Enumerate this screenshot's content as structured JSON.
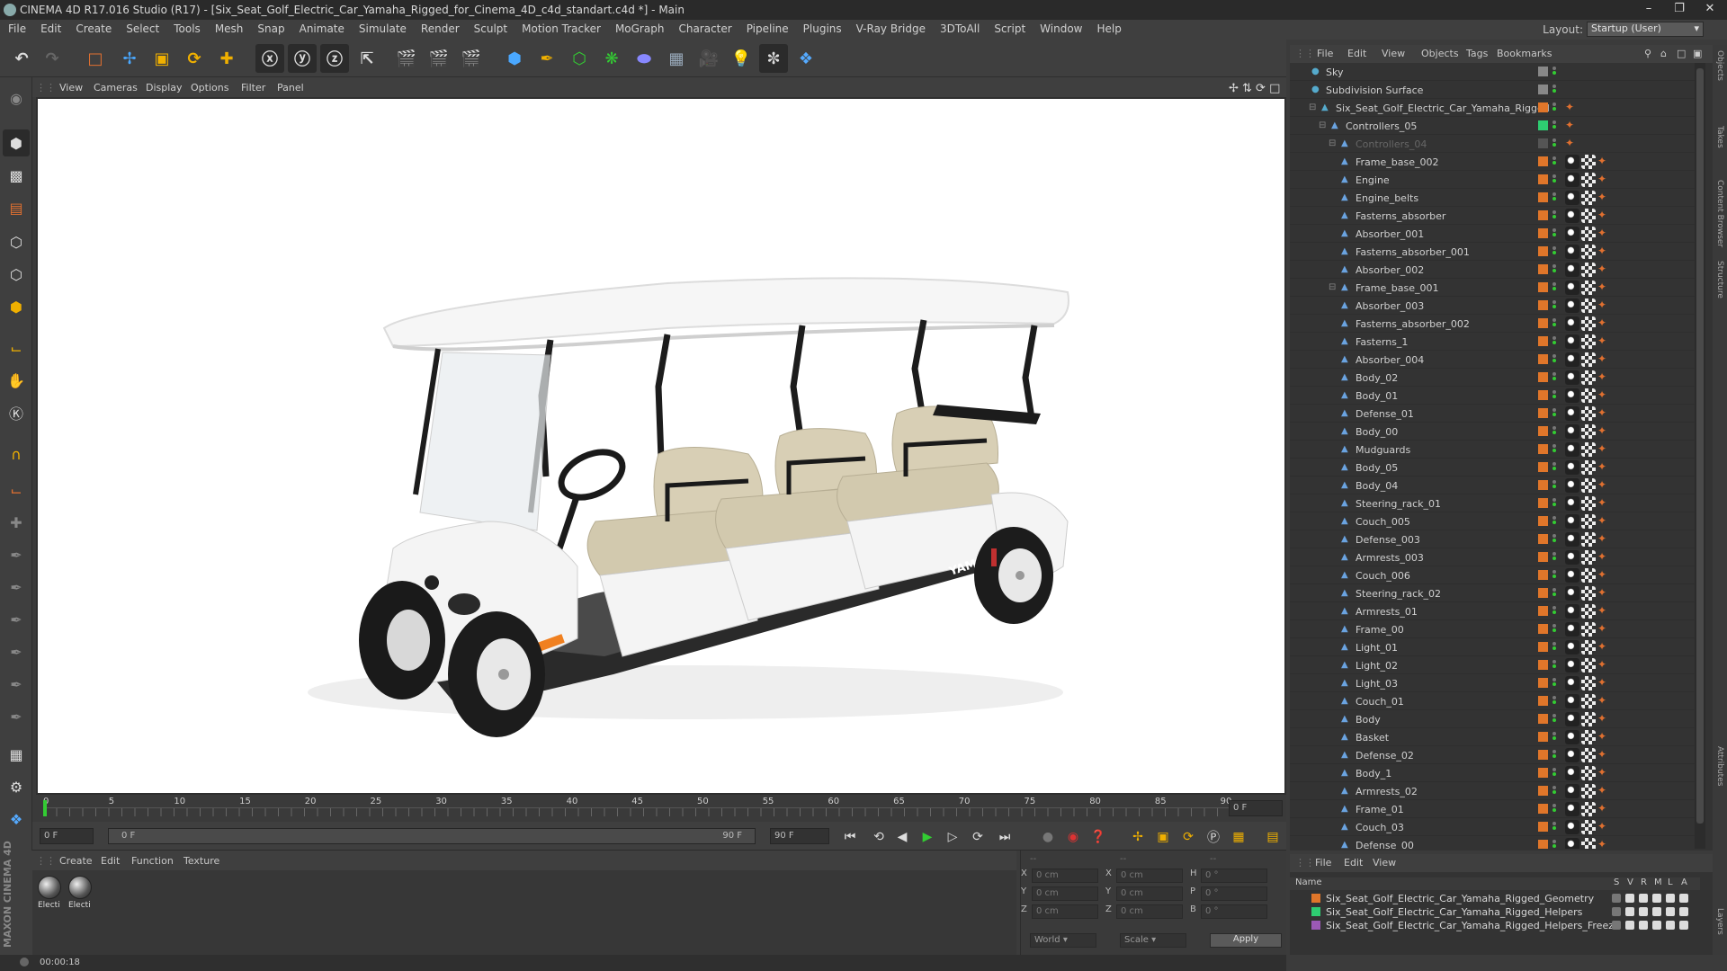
{
  "window": {
    "title": "CINEMA 4D R17.016 Studio (R17) - [Six_Seat_Golf_Electric_Car_Yamaha_Rigged_for_Cinema_4D_c4d_standart.c4d *] - Main"
  },
  "menubar": {
    "items": [
      "File",
      "Edit",
      "Create",
      "Select",
      "Tools",
      "Mesh",
      "Snap",
      "Animate",
      "Simulate",
      "Render",
      "Sculpt",
      "Motion Tracker",
      "MoGraph",
      "Character",
      "Pipeline",
      "Plugins",
      "V-Ray Bridge",
      "3DToAll",
      "Script",
      "Window",
      "Help"
    ],
    "layout_label": "Layout:",
    "layout_value": "Startup (User)"
  },
  "viewport": {
    "menu": [
      "View",
      "Cameras",
      "Display",
      "Options",
      "Filter",
      "Panel"
    ],
    "brand_text": "YAMAHA"
  },
  "timeline": {
    "ticks": [
      "0",
      "5",
      "10",
      "15",
      "20",
      "25",
      "30",
      "35",
      "40",
      "45",
      "50",
      "55",
      "60",
      "65",
      "70",
      "75",
      "80",
      "85",
      "90"
    ],
    "frame_end_field": "0 F",
    "current_frame": "0 F",
    "range_start": "0 F",
    "range_end": "90 F",
    "max_frame": "90 F"
  },
  "material_manager": {
    "menu": [
      "Create",
      "Edit",
      "Function",
      "Texture"
    ],
    "materials": [
      "Electi",
      "Electi"
    ]
  },
  "coordinates": {
    "rows": [
      {
        "axis": "X",
        "pos": "0 cm",
        "axis2": "X",
        "size": "0 cm",
        "axis3": "H",
        "rot": "0 °"
      },
      {
        "axis": "Y",
        "pos": "0 cm",
        "axis2": "Y",
        "size": "0 cm",
        "axis3": "P",
        "rot": "0 °"
      },
      {
        "axis": "Z",
        "pos": "0 cm",
        "axis2": "Z",
        "size": "0 cm",
        "axis3": "B",
        "rot": "0 °"
      }
    ],
    "world": "World",
    "scale": "Scale",
    "apply": "Apply",
    "headers": [
      "--",
      "--",
      "--"
    ]
  },
  "status": {
    "time": "00:00:18"
  },
  "logo": "MAXON CINEMA 4D",
  "object_manager": {
    "menu": [
      "File",
      "Edit",
      "View",
      "Objects",
      "Tags",
      "Bookmarks"
    ],
    "objects": [
      {
        "name": "Sky",
        "indent": 0,
        "color": "#888888"
      },
      {
        "name": "Subdivision Surface",
        "indent": 0,
        "color": "#888888"
      },
      {
        "name": "Six_Seat_Golf_Electric_Car_Yamaha_Rigged",
        "indent": 1,
        "color": "#e0762a"
      },
      {
        "name": "Controllers_05",
        "indent": 2,
        "color": "#2ecc71"
      },
      {
        "name": "Controllers_04",
        "indent": 3,
        "color": "#555555",
        "dim": true
      },
      {
        "name": "Frame_base_002",
        "indent": 3,
        "color": "#e0762a"
      },
      {
        "name": "Engine",
        "indent": 3,
        "color": "#e0762a"
      },
      {
        "name": "Engine_belts",
        "indent": 3,
        "color": "#e0762a"
      },
      {
        "name": "Fasterns_absorber",
        "indent": 3,
        "color": "#e0762a"
      },
      {
        "name": "Absorber_001",
        "indent": 3,
        "color": "#e0762a"
      },
      {
        "name": "Fasterns_absorber_001",
        "indent": 3,
        "color": "#e0762a"
      },
      {
        "name": "Absorber_002",
        "indent": 3,
        "color": "#e0762a"
      },
      {
        "name": "Frame_base_001",
        "indent": 3,
        "color": "#e0762a"
      },
      {
        "name": "Absorber_003",
        "indent": 3,
        "color": "#e0762a"
      },
      {
        "name": "Fasterns_absorber_002",
        "indent": 3,
        "color": "#e0762a"
      },
      {
        "name": "Fasterns_1",
        "indent": 3,
        "color": "#e0762a"
      },
      {
        "name": "Absorber_004",
        "indent": 3,
        "color": "#e0762a"
      },
      {
        "name": "Body_02",
        "indent": 3,
        "color": "#e0762a"
      },
      {
        "name": "Body_01",
        "indent": 3,
        "color": "#e0762a"
      },
      {
        "name": "Defense_01",
        "indent": 3,
        "color": "#e0762a"
      },
      {
        "name": "Body_00",
        "indent": 3,
        "color": "#e0762a"
      },
      {
        "name": "Mudguards",
        "indent": 3,
        "color": "#e0762a"
      },
      {
        "name": "Body_05",
        "indent": 3,
        "color": "#e0762a"
      },
      {
        "name": "Body_04",
        "indent": 3,
        "color": "#e0762a"
      },
      {
        "name": "Steering_rack_01",
        "indent": 3,
        "color": "#e0762a"
      },
      {
        "name": "Couch_005",
        "indent": 3,
        "color": "#e0762a"
      },
      {
        "name": "Defense_003",
        "indent": 3,
        "color": "#e0762a"
      },
      {
        "name": "Armrests_003",
        "indent": 3,
        "color": "#e0762a"
      },
      {
        "name": "Couch_006",
        "indent": 3,
        "color": "#e0762a"
      },
      {
        "name": "Steering_rack_02",
        "indent": 3,
        "color": "#e0762a"
      },
      {
        "name": "Armrests_01",
        "indent": 3,
        "color": "#e0762a"
      },
      {
        "name": "Frame_00",
        "indent": 3,
        "color": "#e0762a"
      },
      {
        "name": "Light_01",
        "indent": 3,
        "color": "#e0762a"
      },
      {
        "name": "Light_02",
        "indent": 3,
        "color": "#e0762a"
      },
      {
        "name": "Light_03",
        "indent": 3,
        "color": "#e0762a"
      },
      {
        "name": "Couch_01",
        "indent": 3,
        "color": "#e0762a"
      },
      {
        "name": "Body",
        "indent": 3,
        "color": "#e0762a"
      },
      {
        "name": "Basket",
        "indent": 3,
        "color": "#e0762a"
      },
      {
        "name": "Defense_02",
        "indent": 3,
        "color": "#e0762a"
      },
      {
        "name": "Body_1",
        "indent": 3,
        "color": "#e0762a"
      },
      {
        "name": "Armrests_02",
        "indent": 3,
        "color": "#e0762a"
      },
      {
        "name": "Frame_01",
        "indent": 3,
        "color": "#e0762a"
      },
      {
        "name": "Couch_03",
        "indent": 3,
        "color": "#e0762a"
      },
      {
        "name": "Defense_00",
        "indent": 3,
        "color": "#e0762a"
      }
    ]
  },
  "layer_manager": {
    "menu": [
      "File",
      "Edit",
      "View"
    ],
    "header_name": "Name",
    "header_cols": [
      "S",
      "V",
      "R",
      "M",
      "L",
      "A"
    ],
    "layers": [
      {
        "name": "Six_Seat_Golf_Electric_Car_Yamaha_Rigged_Geometry",
        "color": "#e0762a"
      },
      {
        "name": "Six_Seat_Golf_Electric_Car_Yamaha_Rigged_Helpers",
        "color": "#2ecc71"
      },
      {
        "name": "Six_Seat_Golf_Electric_Car_Yamaha_Rigged_Helpers_Freeze",
        "color": "#9b59b6"
      }
    ]
  },
  "right_tabs": [
    "Objects",
    "Takes",
    "Content Browser",
    "Structure",
    "Attributes",
    "Layers"
  ]
}
